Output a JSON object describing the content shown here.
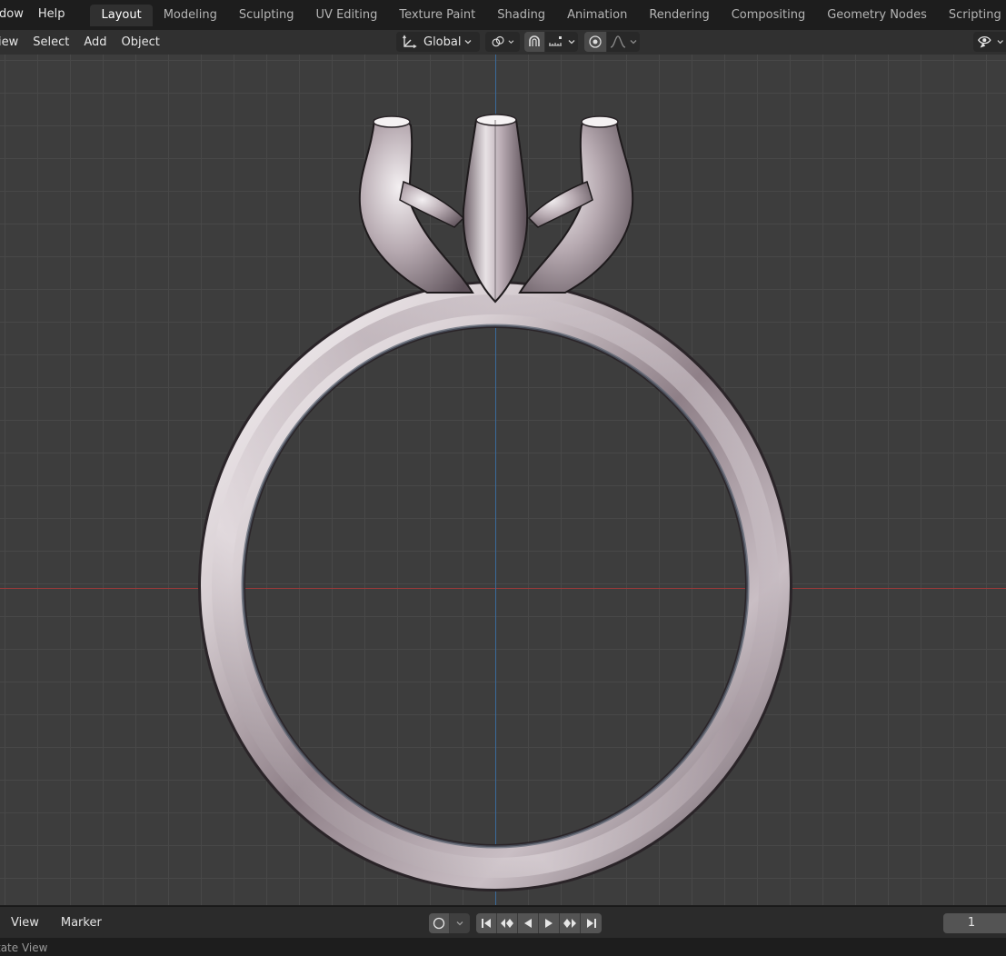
{
  "topbar": {
    "menus": [
      "dow",
      "Help"
    ],
    "tabs": [
      "Layout",
      "Modeling",
      "Sculpting",
      "UV Editing",
      "Texture Paint",
      "Shading",
      "Animation",
      "Rendering",
      "Compositing",
      "Geometry Nodes",
      "Scripting"
    ],
    "active_tab": "Layout",
    "more": "+"
  },
  "header": {
    "menus": [
      "iew",
      "Select",
      "Add",
      "Object"
    ],
    "transform_orientation": "Global",
    "icons": [
      "transform-orientation-icon",
      "pivot-icon",
      "snap-icon",
      "snap-increment-icon",
      "proportional-edit-icon",
      "falloff-icon",
      "visibility-icon"
    ]
  },
  "viewport": {
    "x_axis_color": "#9b3a3a",
    "y_axis_color": "#3a6a9b",
    "grid_color": "#484848",
    "background": "#3d3d3d",
    "object": "ring-with-prong-setting"
  },
  "timeline": {
    "menus": [
      "View",
      "Marker"
    ],
    "current_frame": "1",
    "controls": [
      "jump-start-icon",
      "prev-keyframe-icon",
      "play-reverse-icon",
      "play-icon",
      "next-keyframe-icon",
      "jump-end-icon"
    ]
  },
  "statusbar": {
    "text": "tate View"
  },
  "colors": {
    "accent_tab": "#303030",
    "panel": "#303030",
    "metal_light": "#f2eef0",
    "metal_dark": "#5e5258"
  }
}
